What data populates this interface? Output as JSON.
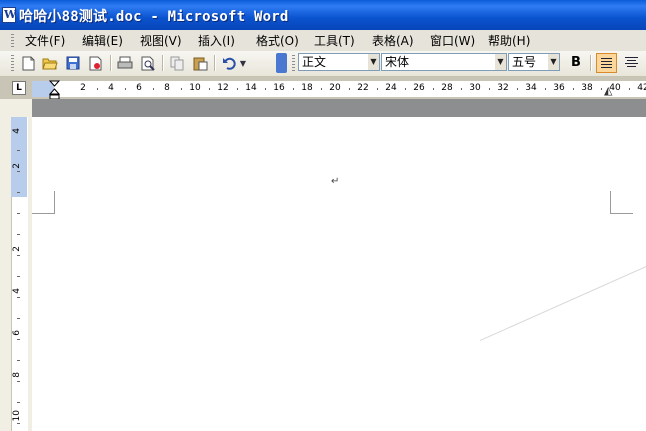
{
  "window": {
    "title": "哈哈小88测试.doc - Microsoft Word"
  },
  "menu": {
    "items": [
      "文件(F)",
      "编辑(E)",
      "视图(V)",
      "插入(I)",
      "格式(O)",
      "工具(T)",
      "表格(A)",
      "窗口(W)",
      "帮助(H)"
    ]
  },
  "toolbar": {
    "buttons": [
      "new-icon",
      "open-icon",
      "save-icon",
      "permission-icon",
      "print-icon",
      "print-preview-icon",
      "copy-icon",
      "paste-icon",
      "undo-icon"
    ],
    "style_value": "正文",
    "font_value": "宋体",
    "size_value": "五号",
    "bold_label": "B"
  },
  "ruler": {
    "tab_selector": "L",
    "h_labels": [
      "2",
      "4",
      "6",
      "8",
      "10",
      "12",
      "14",
      "16",
      "18",
      "20",
      "22",
      "24",
      "26",
      "28",
      "30",
      "32",
      "34",
      "36",
      "38",
      "40",
      "42"
    ],
    "v_labels": [
      "4",
      "2",
      "2",
      "4",
      "6",
      "8",
      "10"
    ]
  },
  "document": {
    "paragraph_mark": "↵"
  },
  "colors": {
    "titlebar": "#0a53cf",
    "menubar": "#e6e4da",
    "active_button": "#fcd79b",
    "ruler_margin": "#b8ccec"
  }
}
